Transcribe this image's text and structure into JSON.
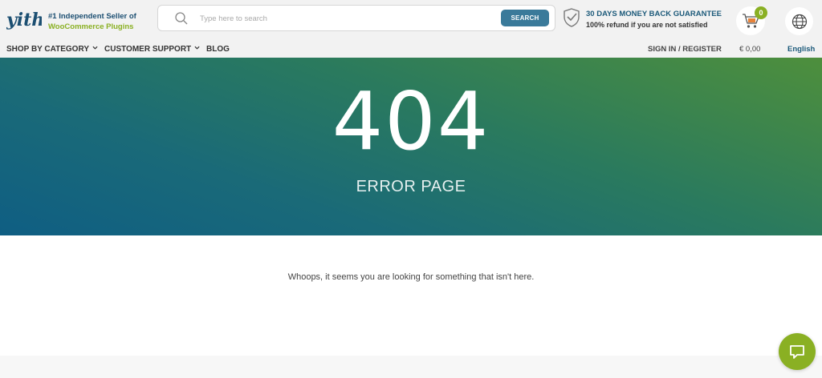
{
  "header": {
    "logo_text": "yith",
    "tagline_line1": "#1 Independent Seller of",
    "tagline_line2": "WooCommerce Plugins",
    "search": {
      "placeholder": "Type here to search",
      "button_label": "SEARCH"
    },
    "guarantee": {
      "title": "30 DAYS MONEY BACK GUARANTEE",
      "subtitle": "100% refund if you are not satisfied"
    },
    "cart": {
      "count": "0",
      "icon": "cart-icon"
    },
    "language_icon": "globe-icon"
  },
  "nav": {
    "shop_by_category": "SHOP BY CATEGORY",
    "customer_support": "CUSTOMER SUPPORT",
    "blog": "BLOG",
    "sign_in": "SIGN IN / REGISTER",
    "cart_total": "€ 0,00",
    "language": "English"
  },
  "hero": {
    "code": "404",
    "label": "ERROR PAGE"
  },
  "main": {
    "message": "Whoops, it seems you are looking for something that isn't here."
  },
  "chat": {
    "icon": "chat-icon"
  },
  "colors": {
    "accent_green": "#8ab023",
    "brand_blue": "#1c4f72",
    "search_button": "#3a7a9a"
  }
}
